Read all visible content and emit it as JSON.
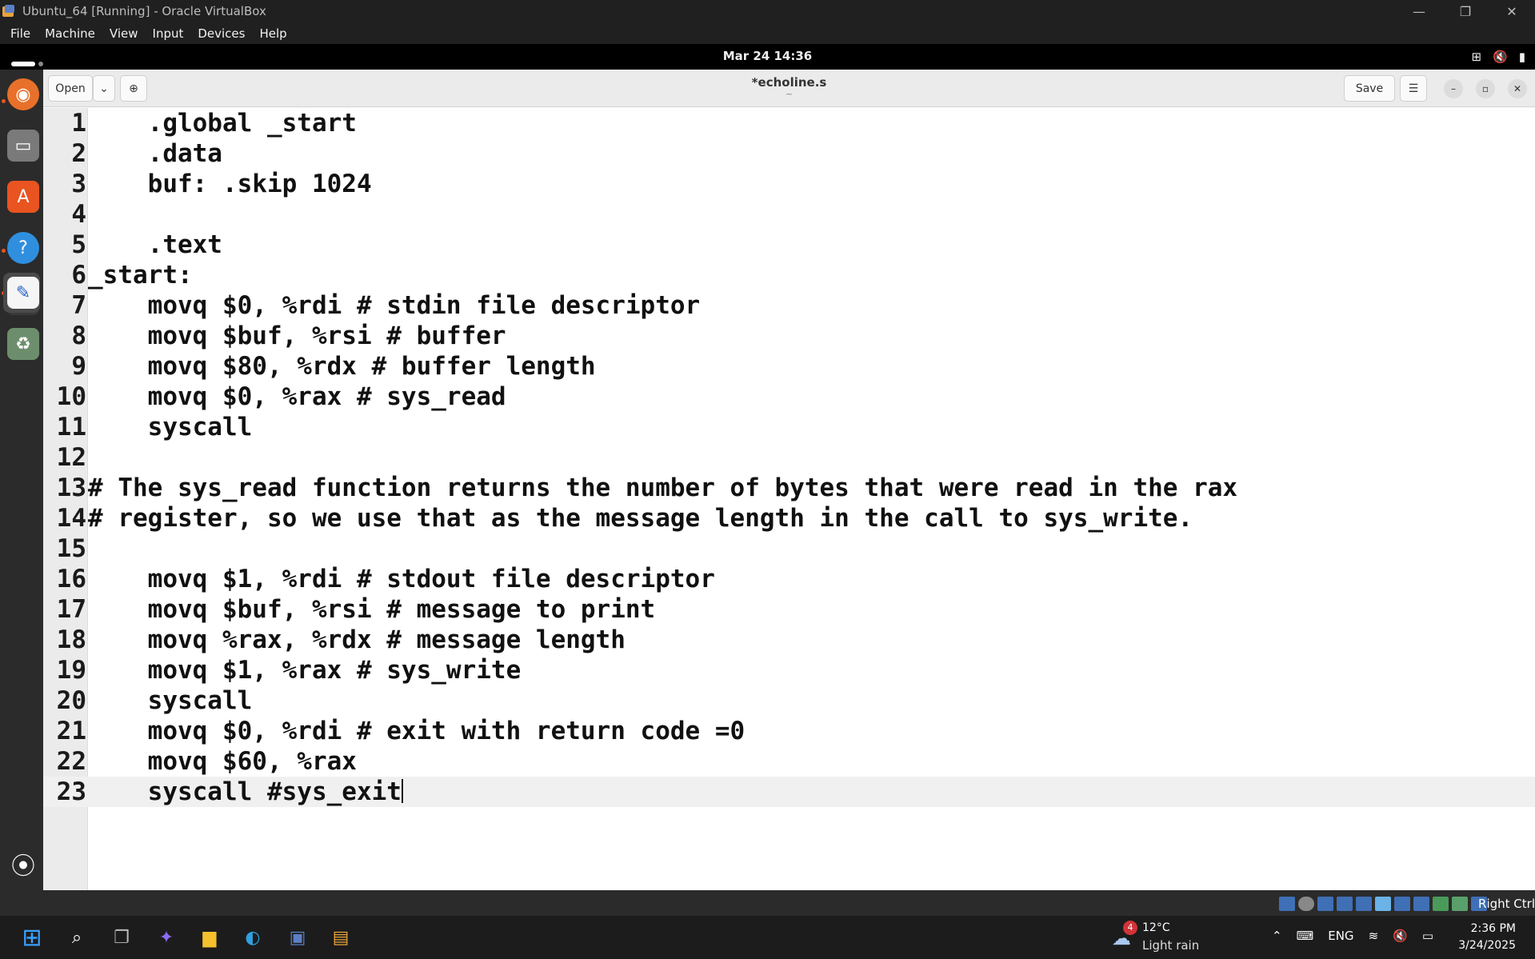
{
  "vbox": {
    "title": "Ubuntu_64 [Running] - Oracle VirtualBox",
    "menu": [
      "File",
      "Machine",
      "View",
      "Input",
      "Devices",
      "Help"
    ],
    "host_key": "Right Ctrl"
  },
  "gnome": {
    "clock": "Mar 24  14:36"
  },
  "gedit": {
    "open_label": "Open",
    "save_label": "Save",
    "doc_title": "*echoline.s",
    "doc_subtitle": "~",
    "lines": [
      {
        "n": "1",
        "text": "    .global _start"
      },
      {
        "n": "2",
        "text": "    .data"
      },
      {
        "n": "3",
        "text": "    buf: .skip 1024"
      },
      {
        "n": "4",
        "text": ""
      },
      {
        "n": "5",
        "text": "    .text"
      },
      {
        "n": "6",
        "text": "_start:"
      },
      {
        "n": "7",
        "text": "    movq $0, %rdi # stdin file descriptor"
      },
      {
        "n": "8",
        "text": "    movq $buf, %rsi # buffer"
      },
      {
        "n": "9",
        "text": "    movq $80, %rdx # buffer length"
      },
      {
        "n": "10",
        "text": "    movq $0, %rax # sys_read"
      },
      {
        "n": "11",
        "text": "    syscall"
      },
      {
        "n": "12",
        "text": ""
      },
      {
        "n": "13",
        "text": "# The sys_read function returns the number of bytes that were read in the rax"
      },
      {
        "n": "14",
        "text": "# register, so we use that as the message length in the call to sys_write."
      },
      {
        "n": "15",
        "text": ""
      },
      {
        "n": "16",
        "text": "    movq $1, %rdi # stdout file descriptor"
      },
      {
        "n": "17",
        "text": "    movq $buf, %rsi # message to print"
      },
      {
        "n": "18",
        "text": "    movq %rax, %rdx # message length"
      },
      {
        "n": "19",
        "text": "    movq $1, %rax # sys_write"
      },
      {
        "n": "20",
        "text": "    syscall"
      },
      {
        "n": "21",
        "text": "    movq $0, %rdi # exit with return code =0"
      },
      {
        "n": "22",
        "text": "    movq $60, %rax"
      },
      {
        "n": "23",
        "text": "    syscall #sys_exit"
      }
    ],
    "current_line": 23
  },
  "windows": {
    "weather_badge": "4",
    "temperature": "12°C",
    "condition": "Light rain",
    "language": "ENG",
    "time": "2:36 PM",
    "date": "3/24/2025"
  }
}
